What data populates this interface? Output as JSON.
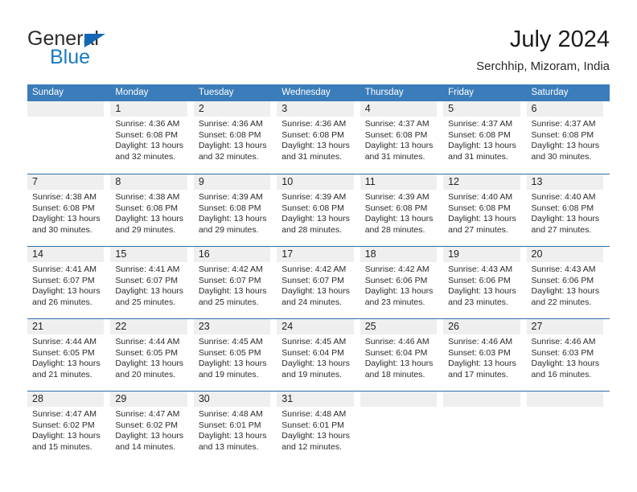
{
  "brand": {
    "word_one": "General",
    "word_two": "Blue",
    "logo_icon": "blue-triangle-icon"
  },
  "header": {
    "title": "July 2024",
    "subtitle": "Serchhip, Mizoram, India"
  },
  "colors": {
    "header_blue": "#3b7cba",
    "row_divider_blue": "#2f6da8",
    "day_band_gray": "#efefef",
    "brand_blue": "#1a7ac4",
    "text": "#222222"
  },
  "calendar": {
    "weekday_headers": [
      "Sunday",
      "Monday",
      "Tuesday",
      "Wednesday",
      "Thursday",
      "Friday",
      "Saturday"
    ],
    "labels": {
      "sunrise": "Sunrise:",
      "sunset": "Sunset:",
      "daylight": "Daylight:"
    },
    "weeks": [
      [
        {
          "day": "",
          "empty": true,
          "line1": "",
          "line2": "",
          "line3": "",
          "line4": ""
        },
        {
          "day": "1",
          "line1": "Sunrise: 4:36 AM",
          "line2": "Sunset: 6:08 PM",
          "line3": "Daylight: 13 hours",
          "line4": "and 32 minutes."
        },
        {
          "day": "2",
          "line1": "Sunrise: 4:36 AM",
          "line2": "Sunset: 6:08 PM",
          "line3": "Daylight: 13 hours",
          "line4": "and 32 minutes."
        },
        {
          "day": "3",
          "line1": "Sunrise: 4:36 AM",
          "line2": "Sunset: 6:08 PM",
          "line3": "Daylight: 13 hours",
          "line4": "and 31 minutes."
        },
        {
          "day": "4",
          "line1": "Sunrise: 4:37 AM",
          "line2": "Sunset: 6:08 PM",
          "line3": "Daylight: 13 hours",
          "line4": "and 31 minutes."
        },
        {
          "day": "5",
          "line1": "Sunrise: 4:37 AM",
          "line2": "Sunset: 6:08 PM",
          "line3": "Daylight: 13 hours",
          "line4": "and 31 minutes."
        },
        {
          "day": "6",
          "line1": "Sunrise: 4:37 AM",
          "line2": "Sunset: 6:08 PM",
          "line3": "Daylight: 13 hours",
          "line4": "and 30 minutes."
        }
      ],
      [
        {
          "day": "7",
          "line1": "Sunrise: 4:38 AM",
          "line2": "Sunset: 6:08 PM",
          "line3": "Daylight: 13 hours",
          "line4": "and 30 minutes."
        },
        {
          "day": "8",
          "line1": "Sunrise: 4:38 AM",
          "line2": "Sunset: 6:08 PM",
          "line3": "Daylight: 13 hours",
          "line4": "and 29 minutes."
        },
        {
          "day": "9",
          "line1": "Sunrise: 4:39 AM",
          "line2": "Sunset: 6:08 PM",
          "line3": "Daylight: 13 hours",
          "line4": "and 29 minutes."
        },
        {
          "day": "10",
          "line1": "Sunrise: 4:39 AM",
          "line2": "Sunset: 6:08 PM",
          "line3": "Daylight: 13 hours",
          "line4": "and 28 minutes."
        },
        {
          "day": "11",
          "line1": "Sunrise: 4:39 AM",
          "line2": "Sunset: 6:08 PM",
          "line3": "Daylight: 13 hours",
          "line4": "and 28 minutes."
        },
        {
          "day": "12",
          "line1": "Sunrise: 4:40 AM",
          "line2": "Sunset: 6:08 PM",
          "line3": "Daylight: 13 hours",
          "line4": "and 27 minutes."
        },
        {
          "day": "13",
          "line1": "Sunrise: 4:40 AM",
          "line2": "Sunset: 6:08 PM",
          "line3": "Daylight: 13 hours",
          "line4": "and 27 minutes."
        }
      ],
      [
        {
          "day": "14",
          "line1": "Sunrise: 4:41 AM",
          "line2": "Sunset: 6:07 PM",
          "line3": "Daylight: 13 hours",
          "line4": "and 26 minutes."
        },
        {
          "day": "15",
          "line1": "Sunrise: 4:41 AM",
          "line2": "Sunset: 6:07 PM",
          "line3": "Daylight: 13 hours",
          "line4": "and 25 minutes."
        },
        {
          "day": "16",
          "line1": "Sunrise: 4:42 AM",
          "line2": "Sunset: 6:07 PM",
          "line3": "Daylight: 13 hours",
          "line4": "and 25 minutes."
        },
        {
          "day": "17",
          "line1": "Sunrise: 4:42 AM",
          "line2": "Sunset: 6:07 PM",
          "line3": "Daylight: 13 hours",
          "line4": "and 24 minutes."
        },
        {
          "day": "18",
          "line1": "Sunrise: 4:42 AM",
          "line2": "Sunset: 6:06 PM",
          "line3": "Daylight: 13 hours",
          "line4": "and 23 minutes."
        },
        {
          "day": "19",
          "line1": "Sunrise: 4:43 AM",
          "line2": "Sunset: 6:06 PM",
          "line3": "Daylight: 13 hours",
          "line4": "and 23 minutes."
        },
        {
          "day": "20",
          "line1": "Sunrise: 4:43 AM",
          "line2": "Sunset: 6:06 PM",
          "line3": "Daylight: 13 hours",
          "line4": "and 22 minutes."
        }
      ],
      [
        {
          "day": "21",
          "line1": "Sunrise: 4:44 AM",
          "line2": "Sunset: 6:05 PM",
          "line3": "Daylight: 13 hours",
          "line4": "and 21 minutes."
        },
        {
          "day": "22",
          "line1": "Sunrise: 4:44 AM",
          "line2": "Sunset: 6:05 PM",
          "line3": "Daylight: 13 hours",
          "line4": "and 20 minutes."
        },
        {
          "day": "23",
          "line1": "Sunrise: 4:45 AM",
          "line2": "Sunset: 6:05 PM",
          "line3": "Daylight: 13 hours",
          "line4": "and 19 minutes."
        },
        {
          "day": "24",
          "line1": "Sunrise: 4:45 AM",
          "line2": "Sunset: 6:04 PM",
          "line3": "Daylight: 13 hours",
          "line4": "and 19 minutes."
        },
        {
          "day": "25",
          "line1": "Sunrise: 4:46 AM",
          "line2": "Sunset: 6:04 PM",
          "line3": "Daylight: 13 hours",
          "line4": "and 18 minutes."
        },
        {
          "day": "26",
          "line1": "Sunrise: 4:46 AM",
          "line2": "Sunset: 6:03 PM",
          "line3": "Daylight: 13 hours",
          "line4": "and 17 minutes."
        },
        {
          "day": "27",
          "line1": "Sunrise: 4:46 AM",
          "line2": "Sunset: 6:03 PM",
          "line3": "Daylight: 13 hours",
          "line4": "and 16 minutes."
        }
      ],
      [
        {
          "day": "28",
          "line1": "Sunrise: 4:47 AM",
          "line2": "Sunset: 6:02 PM",
          "line3": "Daylight: 13 hours",
          "line4": "and 15 minutes."
        },
        {
          "day": "29",
          "line1": "Sunrise: 4:47 AM",
          "line2": "Sunset: 6:02 PM",
          "line3": "Daylight: 13 hours",
          "line4": "and 14 minutes."
        },
        {
          "day": "30",
          "line1": "Sunrise: 4:48 AM",
          "line2": "Sunset: 6:01 PM",
          "line3": "Daylight: 13 hours",
          "line4": "and 13 minutes."
        },
        {
          "day": "31",
          "line1": "Sunrise: 4:48 AM",
          "line2": "Sunset: 6:01 PM",
          "line3": "Daylight: 13 hours",
          "line4": "and 12 minutes."
        },
        {
          "day": "",
          "empty": true,
          "line1": "",
          "line2": "",
          "line3": "",
          "line4": ""
        },
        {
          "day": "",
          "empty": true,
          "line1": "",
          "line2": "",
          "line3": "",
          "line4": ""
        },
        {
          "day": "",
          "empty": true,
          "line1": "",
          "line2": "",
          "line3": "",
          "line4": ""
        }
      ]
    ]
  }
}
